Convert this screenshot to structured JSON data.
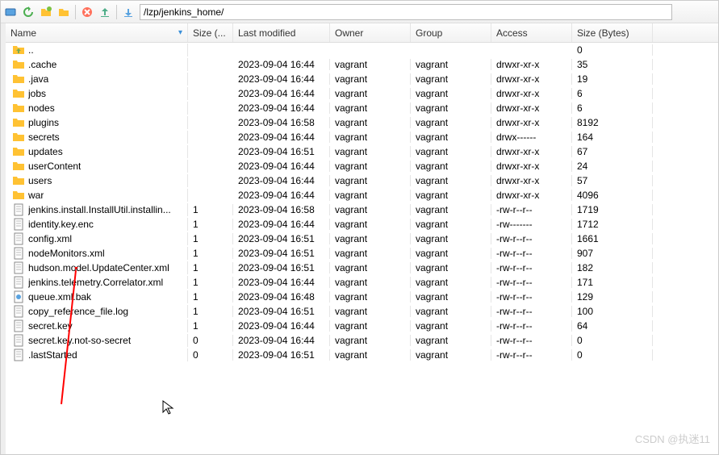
{
  "toolbar": {
    "path": "/lzp/jenkins_home/"
  },
  "columns": {
    "name": "Name",
    "size": "Size (...",
    "modified": "Last modified",
    "owner": "Owner",
    "group": "Group",
    "access": "Access",
    "bytes": "Size (Bytes)"
  },
  "parent": {
    "name": ".."
  },
  "rows": [
    {
      "type": "dir",
      "name": ".cache",
      "size": "",
      "mod": "2023-09-04 16:44",
      "owner": "vagrant",
      "group": "vagrant",
      "access": "drwxr-xr-x",
      "bytes": "35"
    },
    {
      "type": "dir",
      "name": ".java",
      "size": "",
      "mod": "2023-09-04 16:44",
      "owner": "vagrant",
      "group": "vagrant",
      "access": "drwxr-xr-x",
      "bytes": "19"
    },
    {
      "type": "dir",
      "name": "jobs",
      "size": "",
      "mod": "2023-09-04 16:44",
      "owner": "vagrant",
      "group": "vagrant",
      "access": "drwxr-xr-x",
      "bytes": "6"
    },
    {
      "type": "dir",
      "name": "nodes",
      "size": "",
      "mod": "2023-09-04 16:44",
      "owner": "vagrant",
      "group": "vagrant",
      "access": "drwxr-xr-x",
      "bytes": "6"
    },
    {
      "type": "dir",
      "name": "plugins",
      "size": "",
      "mod": "2023-09-04 16:58",
      "owner": "vagrant",
      "group": "vagrant",
      "access": "drwxr-xr-x",
      "bytes": "8192"
    },
    {
      "type": "dir",
      "name": "secrets",
      "size": "",
      "mod": "2023-09-04 16:44",
      "owner": "vagrant",
      "group": "vagrant",
      "access": "drwx------",
      "bytes": "164"
    },
    {
      "type": "dir",
      "name": "updates",
      "size": "",
      "mod": "2023-09-04 16:51",
      "owner": "vagrant",
      "group": "vagrant",
      "access": "drwxr-xr-x",
      "bytes": "67"
    },
    {
      "type": "dir",
      "name": "userContent",
      "size": "",
      "mod": "2023-09-04 16:44",
      "owner": "vagrant",
      "group": "vagrant",
      "access": "drwxr-xr-x",
      "bytes": "24"
    },
    {
      "type": "dir",
      "name": "users",
      "size": "",
      "mod": "2023-09-04 16:44",
      "owner": "vagrant",
      "group": "vagrant",
      "access": "drwxr-xr-x",
      "bytes": "57"
    },
    {
      "type": "dir",
      "name": "war",
      "size": "",
      "mod": "2023-09-04 16:44",
      "owner": "vagrant",
      "group": "vagrant",
      "access": "drwxr-xr-x",
      "bytes": "4096"
    },
    {
      "type": "file",
      "name": "jenkins.install.InstallUtil.installin...",
      "size": "1",
      "mod": "2023-09-04 16:58",
      "owner": "vagrant",
      "group": "vagrant",
      "access": "-rw-r--r--",
      "bytes": "1719"
    },
    {
      "type": "file",
      "name": "identity.key.enc",
      "size": "1",
      "mod": "2023-09-04 16:44",
      "owner": "vagrant",
      "group": "vagrant",
      "access": "-rw-------",
      "bytes": "1712"
    },
    {
      "type": "file",
      "name": "config.xml",
      "size": "1",
      "mod": "2023-09-04 16:51",
      "owner": "vagrant",
      "group": "vagrant",
      "access": "-rw-r--r--",
      "bytes": "1661"
    },
    {
      "type": "file",
      "name": "nodeMonitors.xml",
      "size": "1",
      "mod": "2023-09-04 16:51",
      "owner": "vagrant",
      "group": "vagrant",
      "access": "-rw-r--r--",
      "bytes": "907"
    },
    {
      "type": "file",
      "name": "hudson.model.UpdateCenter.xml",
      "size": "1",
      "mod": "2023-09-04 16:51",
      "owner": "vagrant",
      "group": "vagrant",
      "access": "-rw-r--r--",
      "bytes": "182"
    },
    {
      "type": "file",
      "name": "jenkins.telemetry.Correlator.xml",
      "size": "1",
      "mod": "2023-09-04 16:44",
      "owner": "vagrant",
      "group": "vagrant",
      "access": "-rw-r--r--",
      "bytes": "171"
    },
    {
      "type": "bak",
      "name": "queue.xml.bak",
      "size": "1",
      "mod": "2023-09-04 16:48",
      "owner": "vagrant",
      "group": "vagrant",
      "access": "-rw-r--r--",
      "bytes": "129"
    },
    {
      "type": "file",
      "name": "copy_reference_file.log",
      "size": "1",
      "mod": "2023-09-04 16:51",
      "owner": "vagrant",
      "group": "vagrant",
      "access": "-rw-r--r--",
      "bytes": "100"
    },
    {
      "type": "file",
      "name": "secret.key",
      "size": "1",
      "mod": "2023-09-04 16:44",
      "owner": "vagrant",
      "group": "vagrant",
      "access": "-rw-r--r--",
      "bytes": "64"
    },
    {
      "type": "file",
      "name": "secret.key.not-so-secret",
      "size": "0",
      "mod": "2023-09-04 16:44",
      "owner": "vagrant",
      "group": "vagrant",
      "access": "-rw-r--r--",
      "bytes": "0"
    },
    {
      "type": "file",
      "name": ".lastStarted",
      "size": "0",
      "mod": "2023-09-04 16:51",
      "owner": "vagrant",
      "group": "vagrant",
      "access": "-rw-r--r--",
      "bytes": "0"
    }
  ],
  "parent_bytes": "0",
  "watermark": "CSDN @执迷11"
}
